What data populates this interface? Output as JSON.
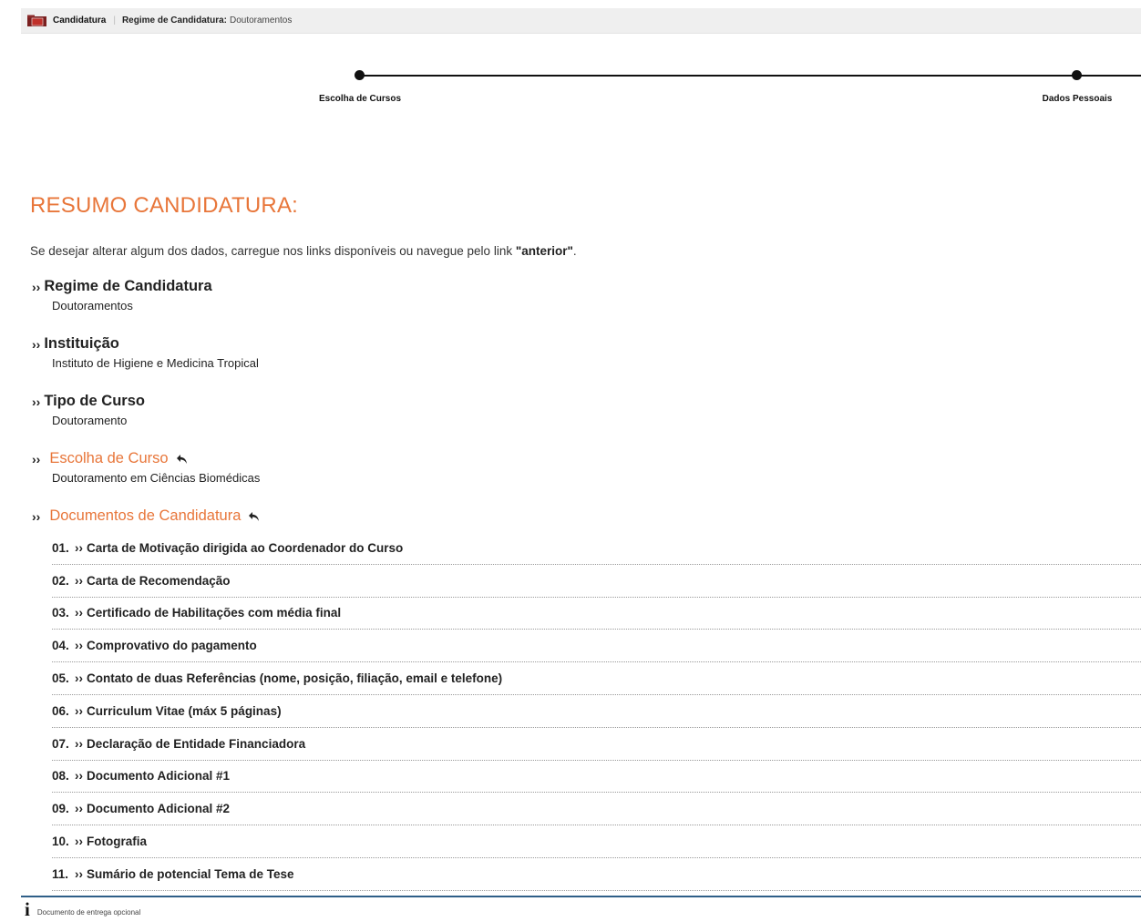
{
  "header": {
    "app_title": "Candidatura",
    "regime_label": "Regime de Candidatura:",
    "regime_value": "Doutoramentos"
  },
  "stepper": {
    "steps": [
      {
        "label": "Escolha de Cursos"
      },
      {
        "label": "Dados Pessoais"
      }
    ]
  },
  "summary": {
    "title": "RESUMO CANDIDATURA:",
    "intro_text": "Se desejar alterar algum dos dados, carregue nos links disponíveis ou navegue pelo link ",
    "intro_link": "\"anterior\"",
    "intro_end": "."
  },
  "sections": {
    "regime": {
      "title": "Regime de Candidatura",
      "value": "Doutoramentos"
    },
    "instituicao": {
      "title": "Instituição",
      "value": "Instituto de Higiene e Medicina Tropical"
    },
    "tipo": {
      "title": "Tipo de Curso",
      "value": "Doutoramento"
    },
    "escolha": {
      "title": "Escolha de Curso",
      "value": "Doutoramento em Ciências Biomédicas"
    },
    "documentos": {
      "title": "Documentos de Candidatura"
    }
  },
  "documents": [
    {
      "num": "01.",
      "label": "Carta de Motivação dirigida ao Coordenador do Curso"
    },
    {
      "num": "02.",
      "label": "Carta de Recomendação"
    },
    {
      "num": "03.",
      "label": "Certificado de Habilitações com média final"
    },
    {
      "num": "04.",
      "label": "Comprovativo do pagamento"
    },
    {
      "num": "05.",
      "label": "Contato de duas Referências (nome, posição, filiação, email e telefone)"
    },
    {
      "num": "06.",
      "label": "Curriculum Vitae (máx 5 páginas)"
    },
    {
      "num": "07.",
      "label": "Declaração de Entidade Financiadora"
    },
    {
      "num": "08.",
      "label": "Documento Adicional #1"
    },
    {
      "num": "09.",
      "label": "Documento Adicional #2"
    },
    {
      "num": "10.",
      "label": "Fotografia"
    },
    {
      "num": "11.",
      "label": "Sumário de potencial Tema de Tese"
    }
  ],
  "footer": {
    "note": "Documento de entrega opcional"
  },
  "colors": {
    "accent": "#e8763a",
    "footer_line": "#2f5f88"
  }
}
